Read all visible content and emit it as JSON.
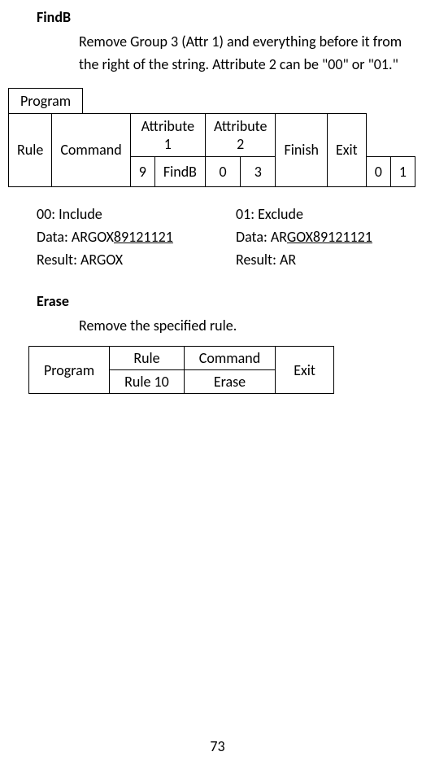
{
  "findB": {
    "title": "FindB",
    "desc": "Remove Group 3 (Attr 1) and everything before it from the right of the string. Attribute 2 can be \"00\" or \"01.\""
  },
  "table1": {
    "programTab": "Program",
    "headers": {
      "rule": "Rule",
      "command": "Command",
      "attr1": "Attribute 1",
      "attr2": "Attribute 2",
      "finish": "Finish",
      "exit": "Exit"
    },
    "row": {
      "rule": "9",
      "command": "FindB",
      "a1a": "0",
      "a1b": "3",
      "a2a": "0",
      "a2b": "1"
    }
  },
  "examples": {
    "left": {
      "title": "00: Include",
      "dataLabel": "Data: ARGOX",
      "dataU": "89121121",
      "result": "Result: ARGOX"
    },
    "right": {
      "title": "01: Exclude",
      "dataLabel": "Data: AR",
      "dataU": "GOX89121121",
      "result": "Result: AR"
    }
  },
  "erase": {
    "title": "Erase",
    "desc": "Remove the specified rule."
  },
  "table2": {
    "program": "Program",
    "ruleH": "Rule",
    "commandH": "Command",
    "exit": "Exit",
    "ruleV": "Rule 10",
    "commandV": "Erase"
  },
  "pageNumber": "73"
}
